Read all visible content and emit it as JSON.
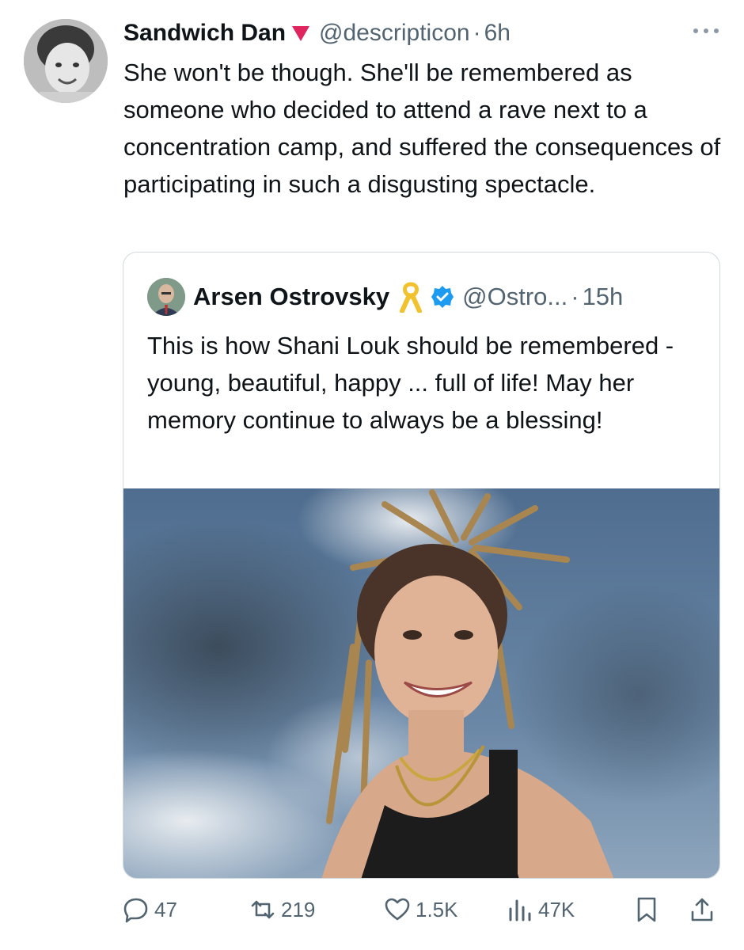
{
  "tweet": {
    "author_name": "Sandwich Dan",
    "handle": "@descripticon",
    "separator": "·",
    "time": "6h",
    "text": "She won't be though. She'll be remembered as someone who decided to attend a rave next to a concentration camp, and suffered the consequences of participating in such a disgusting spectacle."
  },
  "quoted_tweet": {
    "author_name": "Arsen Ostrovsky",
    "handle": "@Ostro...",
    "separator": "·",
    "time": "15h",
    "text": "This is how Shani Louk should be remembered - young, beautiful, happy ... full of life! May her memory continue to always be a blessing!"
  },
  "actions": {
    "replies": "47",
    "reposts": "219",
    "likes": "1.5K",
    "views": "47K"
  },
  "colors": {
    "text": "#0f1419",
    "muted": "#536471",
    "verified": "#1d9bf0",
    "ribbon": "#f2c12e",
    "flag": "#e0245e",
    "border": "#cfd9de"
  },
  "icons": {
    "flag": "red-triangle-icon",
    "more": "more-dots-icon",
    "ribbon": "yellow-ribbon-icon",
    "verified": "verified-badge-icon",
    "reply": "reply-icon",
    "repost": "repost-icon",
    "like": "heart-icon",
    "views": "views-chart-icon",
    "bookmark": "bookmark-icon",
    "share": "share-icon"
  }
}
